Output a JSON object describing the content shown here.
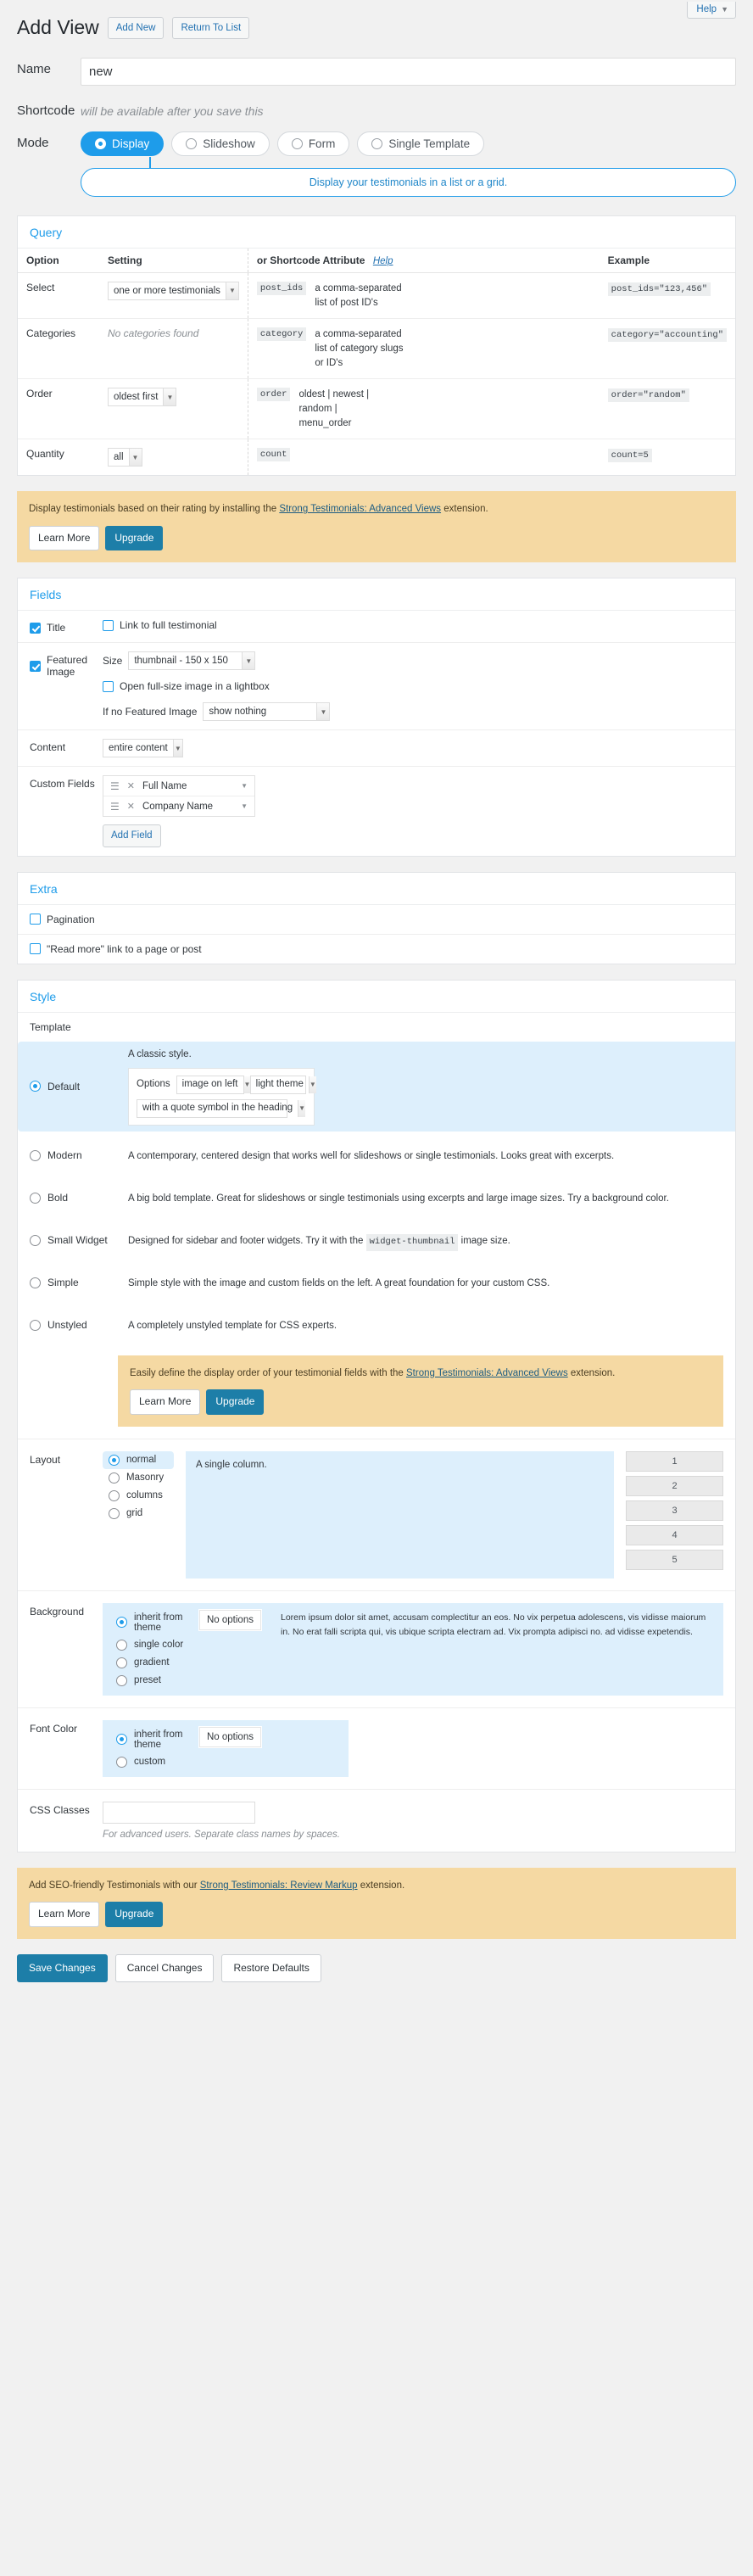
{
  "header": {
    "title": "Add View",
    "add_new_label": "Add New",
    "return_label": "Return To List",
    "help_label": "Help",
    "help_caret": "▼"
  },
  "form": {
    "name_label": "Name",
    "name_value": "new",
    "shortcode_label": "Shortcode",
    "shortcode_placeholder_text": "will be available after you save this",
    "mode_label": "Mode",
    "mode_options": [
      "Display",
      "Slideshow",
      "Form",
      "Single Template"
    ],
    "mode_selected": "Display",
    "mode_description": "Display your testimonials in a list or a grid."
  },
  "query": {
    "panel_title": "Query",
    "columns": [
      "Option",
      "Setting",
      "or Shortcode Attribute",
      "Example"
    ],
    "help_label": "Help",
    "rows": [
      {
        "option": "Select",
        "setting_type": "select",
        "setting_value": "one or more testimonials",
        "attr": "post_ids",
        "attr_desc": "a comma-separated list of post ID's",
        "example": "post_ids=\"123,456\""
      },
      {
        "option": "Categories",
        "setting_type": "text",
        "setting_value": "No categories found",
        "attr": "category",
        "attr_desc": "a comma-separated list of category slugs or ID's",
        "example": "category=\"accounting\""
      },
      {
        "option": "Order",
        "setting_type": "select",
        "setting_value": "oldest first",
        "attr": "order",
        "attr_desc": "oldest | newest | random | menu_order",
        "example": "order=\"random\""
      },
      {
        "option": "Quantity",
        "setting_type": "select",
        "setting_value": "all",
        "attr": "count",
        "attr_desc": "",
        "example": "count=5"
      }
    ]
  },
  "notice_rating": {
    "text_before": "Display testimonials based on their rating by installing the ",
    "link": "Strong Testimonials: Advanced Views",
    "text_after": " extension.",
    "learn_more": "Learn More",
    "upgrade": "Upgrade"
  },
  "fields": {
    "panel_title": "Fields",
    "title_label": "Title",
    "title_checked": true,
    "link_full_label": "Link to full testimonial",
    "link_full_checked": false,
    "featured_image_label": "Featured Image",
    "featured_image_checked": true,
    "size_label": "Size",
    "size_value": "thumbnail - 150 x 150",
    "lightbox_label": "Open full-size image in a lightbox",
    "lightbox_checked": false,
    "if_no_image_label": "If no Featured Image",
    "if_no_image_value": "show nothing",
    "content_label": "Content",
    "content_value": "entire content",
    "custom_fields_label": "Custom Fields",
    "custom_fields": [
      "Full Name",
      "Company Name"
    ],
    "add_field_label": "Add Field"
  },
  "extra": {
    "panel_title": "Extra",
    "pagination_label": "Pagination",
    "pagination_checked": false,
    "readmore_label": "\"Read more\" link to a page or post",
    "readmore_checked": false
  },
  "style": {
    "panel_title": "Style",
    "template_label": "Template",
    "templates": [
      {
        "name": "Default",
        "selected": true,
        "description": "A classic style.",
        "options_label": "Options",
        "option_image": "image on left",
        "option_theme": "light theme",
        "option_quote": "with a quote symbol in the heading"
      },
      {
        "name": "Modern",
        "selected": false,
        "description": "A contemporary, centered design that works well for slideshows or single testimonials. Looks great with excerpts."
      },
      {
        "name": "Bold",
        "selected": false,
        "description": "A big bold template. Great for slideshows or single testimonials using excerpts and large image sizes. Try a background color."
      },
      {
        "name": "Small Widget",
        "selected": false,
        "description_pre": "Designed for sidebar and footer widgets. Try it with the ",
        "description_code": "widget-thumbnail",
        "description_post": " image size."
      },
      {
        "name": "Simple",
        "selected": false,
        "description": "Simple style with the image and custom fields on the left. A great foundation for your custom CSS."
      },
      {
        "name": "Unstyled",
        "selected": false,
        "description": "A completely unstyled template for CSS experts."
      }
    ],
    "notice_order": {
      "text_before": "Easily define the display order of your testimonial fields with the ",
      "link": "Strong Testimonials: Advanced Views",
      "text_after": " extension.",
      "learn_more": "Learn More",
      "upgrade": "Upgrade"
    },
    "layout_label": "Layout",
    "layout_options": [
      "normal",
      "Masonry",
      "columns",
      "grid"
    ],
    "layout_selected": "normal",
    "layout_description": "A single column.",
    "column_preview": [
      "1",
      "2",
      "3",
      "4",
      "5"
    ],
    "background_label": "Background",
    "background_options": [
      "inherit from theme",
      "single color",
      "gradient",
      "preset"
    ],
    "background_selected": "inherit from theme",
    "background_no_options": "No options",
    "background_lorem": "Lorem ipsum dolor sit amet, accusam complectitur an eos. No vix perpetua adolescens, vis vidisse maiorum in. No erat falli scripta qui, vis ubique scripta electram ad. Vix prompta adipisci no. ad vidisse expetendis.",
    "font_color_label": "Font Color",
    "font_color_options": [
      "inherit from theme",
      "custom"
    ],
    "font_color_selected": "inherit from theme",
    "font_color_no_options": "No options",
    "css_classes_label": "CSS Classes",
    "css_classes_value": "",
    "css_classes_hint": "For advanced users. Separate class names by spaces."
  },
  "notice_seo": {
    "text_before": "Add SEO-friendly Testimonials with our ",
    "link": "Strong Testimonials: Review Markup",
    "text_after": " extension.",
    "learn_more": "Learn More",
    "upgrade": "Upgrade"
  },
  "footer": {
    "save_label": "Save Changes",
    "cancel_label": "Cancel Changes",
    "restore_label": "Restore Defaults"
  }
}
